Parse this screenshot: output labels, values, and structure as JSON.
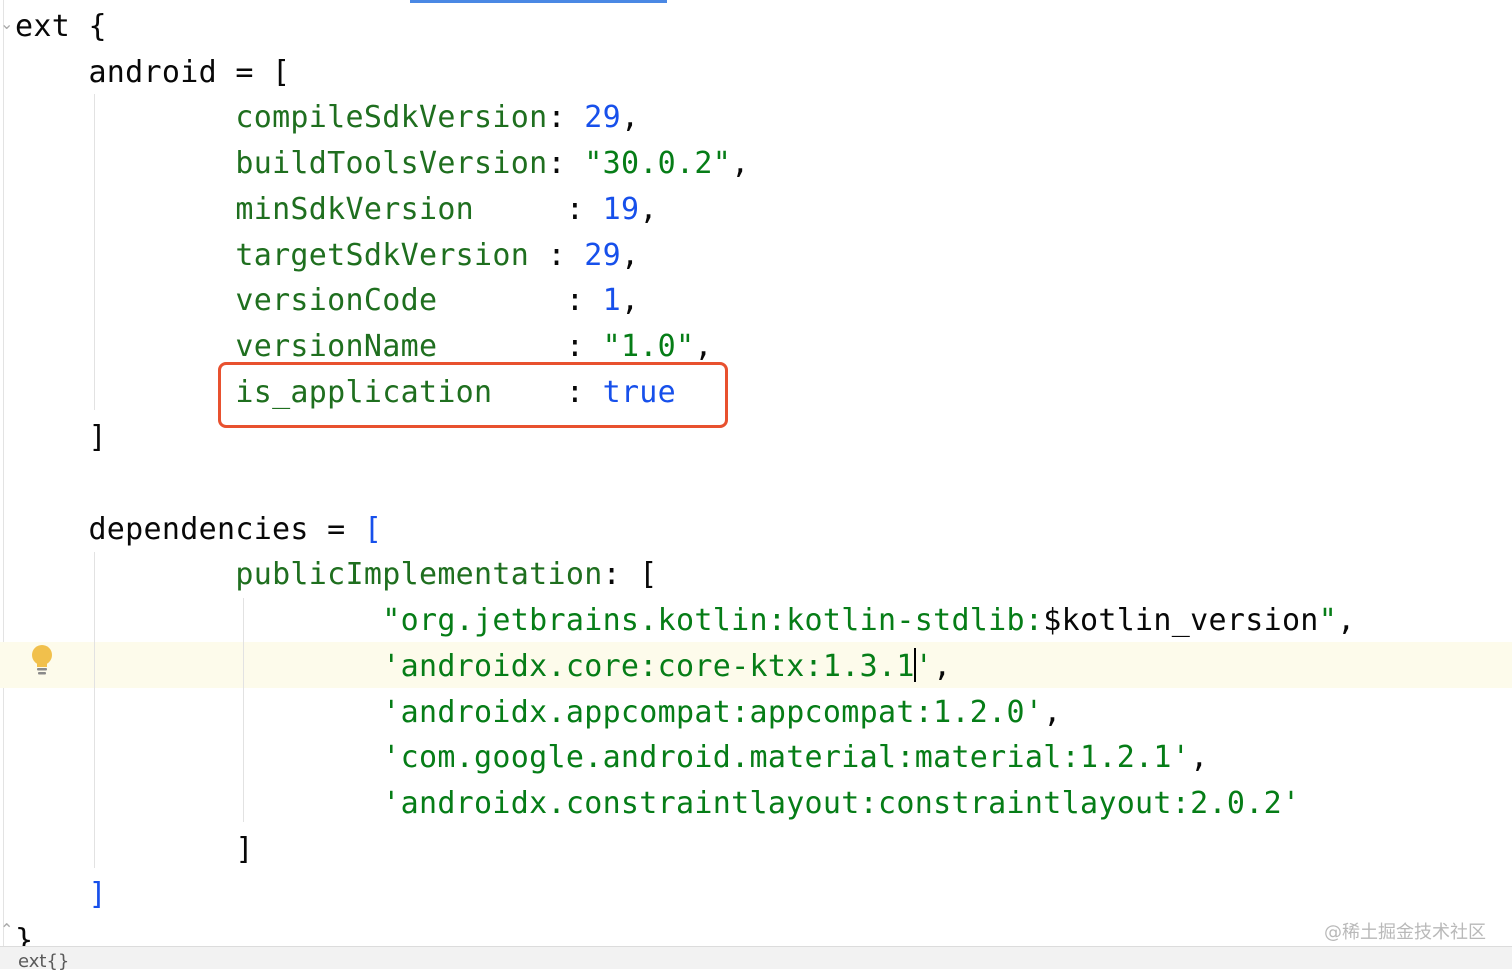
{
  "editor": {
    "lines": [
      {
        "tokens": [
          {
            "t": "ext ",
            "c": "k"
          },
          {
            "t": "{",
            "c": "k"
          }
        ]
      },
      {
        "tokens": [
          {
            "t": "    android = [",
            "c": "k"
          }
        ]
      },
      {
        "tokens": [
          {
            "t": "            ",
            "c": "k"
          },
          {
            "t": "compileSdkVersion",
            "c": "g"
          },
          {
            "t": ": ",
            "c": "k"
          },
          {
            "t": "29",
            "c": "n"
          },
          {
            "t": ",",
            "c": "k"
          }
        ]
      },
      {
        "tokens": [
          {
            "t": "            ",
            "c": "k"
          },
          {
            "t": "buildToolsVersion",
            "c": "g"
          },
          {
            "t": ": ",
            "c": "k"
          },
          {
            "t": "\"30.0.2\"",
            "c": "s"
          },
          {
            "t": ",",
            "c": "k"
          }
        ]
      },
      {
        "tokens": [
          {
            "t": "            ",
            "c": "k"
          },
          {
            "t": "minSdkVersion",
            "c": "g"
          },
          {
            "t": "     : ",
            "c": "k"
          },
          {
            "t": "19",
            "c": "n"
          },
          {
            "t": ",",
            "c": "k"
          }
        ]
      },
      {
        "tokens": [
          {
            "t": "            ",
            "c": "k"
          },
          {
            "t": "targetSdkVersion",
            "c": "g"
          },
          {
            "t": " : ",
            "c": "k"
          },
          {
            "t": "29",
            "c": "n"
          },
          {
            "t": ",",
            "c": "k"
          }
        ]
      },
      {
        "tokens": [
          {
            "t": "            ",
            "c": "k"
          },
          {
            "t": "versionCode",
            "c": "g"
          },
          {
            "t": "       : ",
            "c": "k"
          },
          {
            "t": "1",
            "c": "n"
          },
          {
            "t": ",",
            "c": "k"
          }
        ]
      },
      {
        "tokens": [
          {
            "t": "            ",
            "c": "k"
          },
          {
            "t": "versionName",
            "c": "g"
          },
          {
            "t": "       : ",
            "c": "k"
          },
          {
            "t": "\"1.0\"",
            "c": "s"
          },
          {
            "t": ",",
            "c": "k"
          }
        ]
      },
      {
        "tokens": [
          {
            "t": "            ",
            "c": "k"
          },
          {
            "t": "is_application",
            "c": "g"
          },
          {
            "t": "    : ",
            "c": "k"
          },
          {
            "t": "true",
            "c": "b"
          }
        ]
      },
      {
        "tokens": [
          {
            "t": "    ]",
            "c": "k"
          }
        ]
      },
      {
        "tokens": [
          {
            "t": "",
            "c": "k"
          }
        ]
      },
      {
        "tokens": [
          {
            "t": "    dependencies = ",
            "c": "k"
          },
          {
            "t": "[",
            "c": "b"
          }
        ]
      },
      {
        "tokens": [
          {
            "t": "            ",
            "c": "k"
          },
          {
            "t": "publicImplementation",
            "c": "g"
          },
          {
            "t": ": [",
            "c": "k"
          }
        ]
      },
      {
        "tokens": [
          {
            "t": "                    ",
            "c": "k"
          },
          {
            "t": "\"org.jetbrains.kotlin:kotlin-stdlib:",
            "c": "s"
          },
          {
            "t": "$kotlin_version",
            "c": "k"
          },
          {
            "t": "\"",
            "c": "s"
          },
          {
            "t": ",",
            "c": "k"
          }
        ]
      },
      {
        "tokens": [
          {
            "t": "                    ",
            "c": "k"
          },
          {
            "t": "'androidx.core:core-ktx:1.3.1",
            "c": "s"
          },
          {
            "t": "|",
            "c": "cursor"
          },
          {
            "t": "'",
            "c": "s"
          },
          {
            "t": ",",
            "c": "k"
          }
        ]
      },
      {
        "tokens": [
          {
            "t": "                    ",
            "c": "k"
          },
          {
            "t": "'androidx.appcompat:appcompat:1.2.0'",
            "c": "s"
          },
          {
            "t": ",",
            "c": "k"
          }
        ]
      },
      {
        "tokens": [
          {
            "t": "                    ",
            "c": "k"
          },
          {
            "t": "'com.google.android.material:material:1.2.1'",
            "c": "s"
          },
          {
            "t": ",",
            "c": "k"
          }
        ]
      },
      {
        "tokens": [
          {
            "t": "                    ",
            "c": "k"
          },
          {
            "t": "'androidx.constraintlayout:constraintlayout:2.0.2'",
            "c": "s"
          }
        ]
      },
      {
        "tokens": [
          {
            "t": "            ]",
            "c": "k"
          }
        ]
      },
      {
        "tokens": [
          {
            "t": "    ",
            "c": "k"
          },
          {
            "t": "]",
            "c": "b"
          }
        ]
      },
      {
        "tokens": [
          {
            "t": "}",
            "c": "k"
          }
        ]
      }
    ],
    "highlighted_line": "is_application",
    "current_line": 15
  },
  "gutter": {
    "intention_icon": "lightbulb-icon"
  },
  "breadcrumb": {
    "text": "ext{}"
  },
  "watermark": {
    "text": "@稀土掘金技术社区"
  },
  "colors": {
    "keyword": "#080808",
    "property": "#1f6f1f",
    "number": "#1750eb",
    "string": "#067d17",
    "highlight_box": "#e8512f",
    "current_line_bg": "#fdfbeb"
  }
}
